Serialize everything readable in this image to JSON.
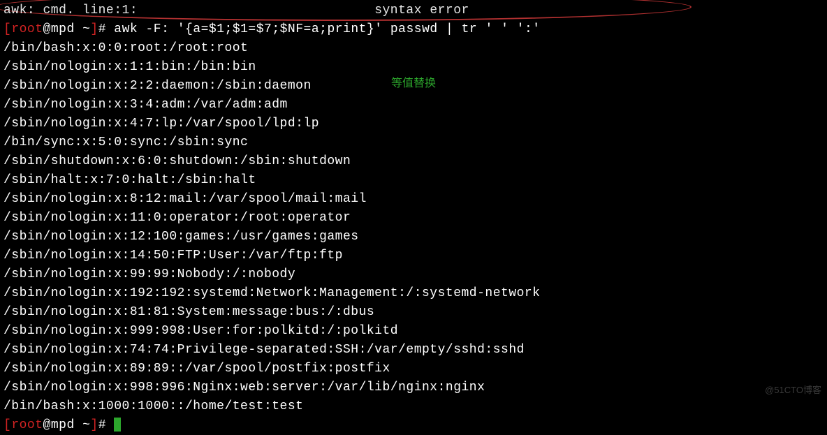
{
  "top_partial_left": "awk: cmd. line:1:",
  "top_partial_right": "syntax error",
  "prompt": {
    "bracket_open": "[",
    "user": "root",
    "at": "@",
    "host": "mpd",
    "path": "~",
    "bracket_close": "]",
    "hash": "# "
  },
  "command": "awk -F: '{a=$1;$1=$7;$NF=a;print}' passwd | tr ' ' ':'",
  "output_lines": [
    "/bin/bash:x:0:0:root:/root:root",
    "/sbin/nologin:x:1:1:bin:/bin:bin",
    "/sbin/nologin:x:2:2:daemon:/sbin:daemon",
    "/sbin/nologin:x:3:4:adm:/var/adm:adm",
    "/sbin/nologin:x:4:7:lp:/var/spool/lpd:lp",
    "/bin/sync:x:5:0:sync:/sbin:sync",
    "/sbin/shutdown:x:6:0:shutdown:/sbin:shutdown",
    "/sbin/halt:x:7:0:halt:/sbin:halt",
    "/sbin/nologin:x:8:12:mail:/var/spool/mail:mail",
    "/sbin/nologin:x:11:0:operator:/root:operator",
    "/sbin/nologin:x:12:100:games:/usr/games:games",
    "/sbin/nologin:x:14:50:FTP:User:/var/ftp:ftp",
    "/sbin/nologin:x:99:99:Nobody:/:nobody",
    "/sbin/nologin:x:192:192:systemd:Network:Management:/:systemd-network",
    "/sbin/nologin:x:81:81:System:message:bus:/:dbus",
    "/sbin/nologin:x:999:998:User:for:polkitd:/:polkitd",
    "/sbin/nologin:x:74:74:Privilege-separated:SSH:/var/empty/sshd:sshd",
    "/sbin/nologin:x:89:89::/var/spool/postfix:postfix",
    "/sbin/nologin:x:998:996:Nginx:web:server:/var/lib/nginx:nginx",
    "/bin/bash:x:1000:1000::/home/test:test"
  ],
  "annotation": "等值替换",
  "watermark": "@51CTO博客"
}
